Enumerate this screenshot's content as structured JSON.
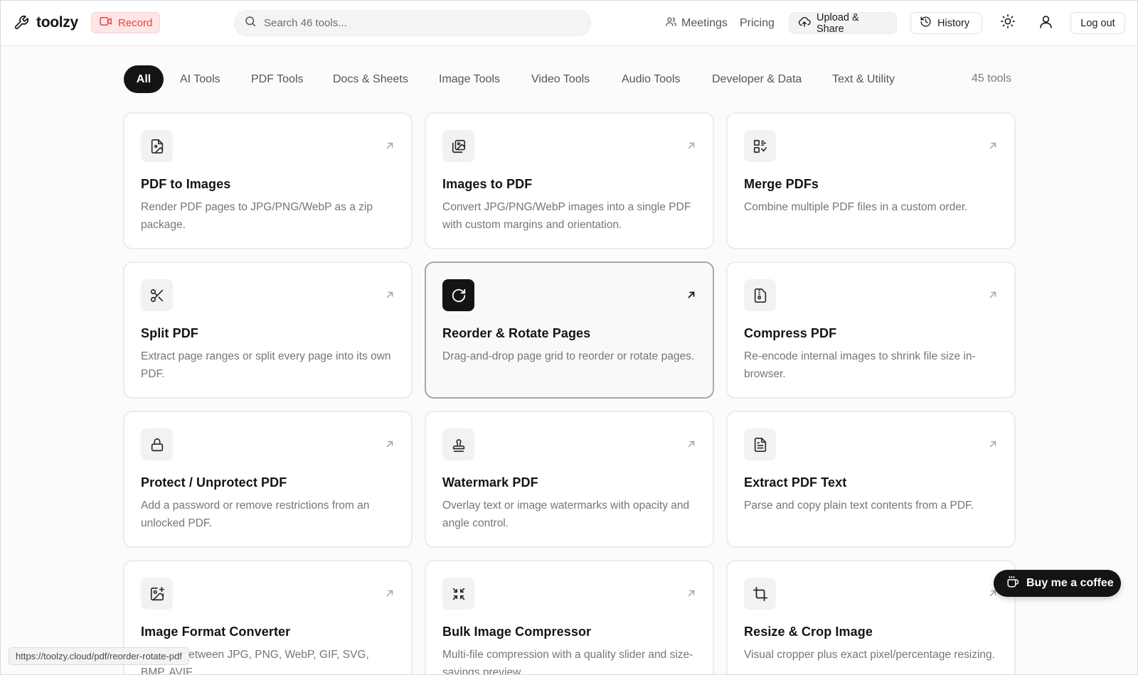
{
  "header": {
    "brand": "toolzy",
    "record_label": "Record",
    "search_placeholder": "Search 46 tools...",
    "nav": {
      "meetings": "Meetings",
      "pricing": "Pricing"
    },
    "upload_label": "Upload & Share",
    "history_label": "History",
    "logout_label": "Log out",
    "icons": {
      "brand": "wrench-icon",
      "record": "video-camera-icon",
      "search": "search-icon",
      "meetings": "users-icon",
      "upload": "cloud-upload-icon",
      "history": "history-icon",
      "theme": "sun-icon",
      "account": "user-icon"
    },
    "colors": {
      "record_text": "#e14646",
      "record_bg": "#fde6e6"
    }
  },
  "tabs": {
    "items": [
      {
        "label": "All",
        "active": true
      },
      {
        "label": "AI Tools"
      },
      {
        "label": "PDF Tools"
      },
      {
        "label": "Docs & Sheets"
      },
      {
        "label": "Image Tools"
      },
      {
        "label": "Video Tools"
      },
      {
        "label": "Audio Tools"
      },
      {
        "label": "Developer & Data"
      },
      {
        "label": "Text & Utility"
      }
    ],
    "count_label": "45 tools"
  },
  "tools": [
    {
      "title": "PDF to Images",
      "desc": "Render PDF pages to JPG/PNG/WebP as a zip package.",
      "icon": "file-image-icon"
    },
    {
      "title": "Images to PDF",
      "desc": "Convert JPG/PNG/WebP images into a single PDF with custom margins and orientation.",
      "icon": "images-icon"
    },
    {
      "title": "Merge PDFs",
      "desc": "Combine multiple PDF files in a custom order.",
      "icon": "merge-icon"
    },
    {
      "title": "Split PDF",
      "desc": "Extract page ranges or split every page into its own PDF.",
      "icon": "scissors-icon"
    },
    {
      "title": "Reorder & Rotate Pages",
      "desc": "Drag-and-drop page grid to reorder or rotate pages.",
      "icon": "rotate-icon",
      "hovered": true
    },
    {
      "title": "Compress PDF",
      "desc": "Re-encode internal images to shrink file size in-browser.",
      "icon": "file-archive-icon"
    },
    {
      "title": "Protect / Unprotect PDF",
      "desc": "Add a password or remove restrictions from an unlocked PDF.",
      "icon": "lock-icon"
    },
    {
      "title": "Watermark PDF",
      "desc": "Overlay text or image watermarks with opacity and angle control.",
      "icon": "stamp-icon"
    },
    {
      "title": "Extract PDF Text",
      "desc": "Parse and copy plain text contents from a PDF.",
      "icon": "file-text-icon"
    },
    {
      "title": "Image Format Converter",
      "desc": "Convert between JPG, PNG, WebP, GIF, SVG, BMP, AVIF.",
      "icon": "image-plus-icon"
    },
    {
      "title": "Bulk Image Compressor",
      "desc": "Multi-file compression with a quality slider and size-savings preview.",
      "icon": "shrink-icon"
    },
    {
      "title": "Resize & Crop Image",
      "desc": "Visual cropper plus exact pixel/percentage resizing.",
      "icon": "crop-icon"
    }
  ],
  "coffee_label": "Buy me a coffee",
  "status_url": "https://toolzy.cloud/pdf/reorder-rotate-pdf"
}
